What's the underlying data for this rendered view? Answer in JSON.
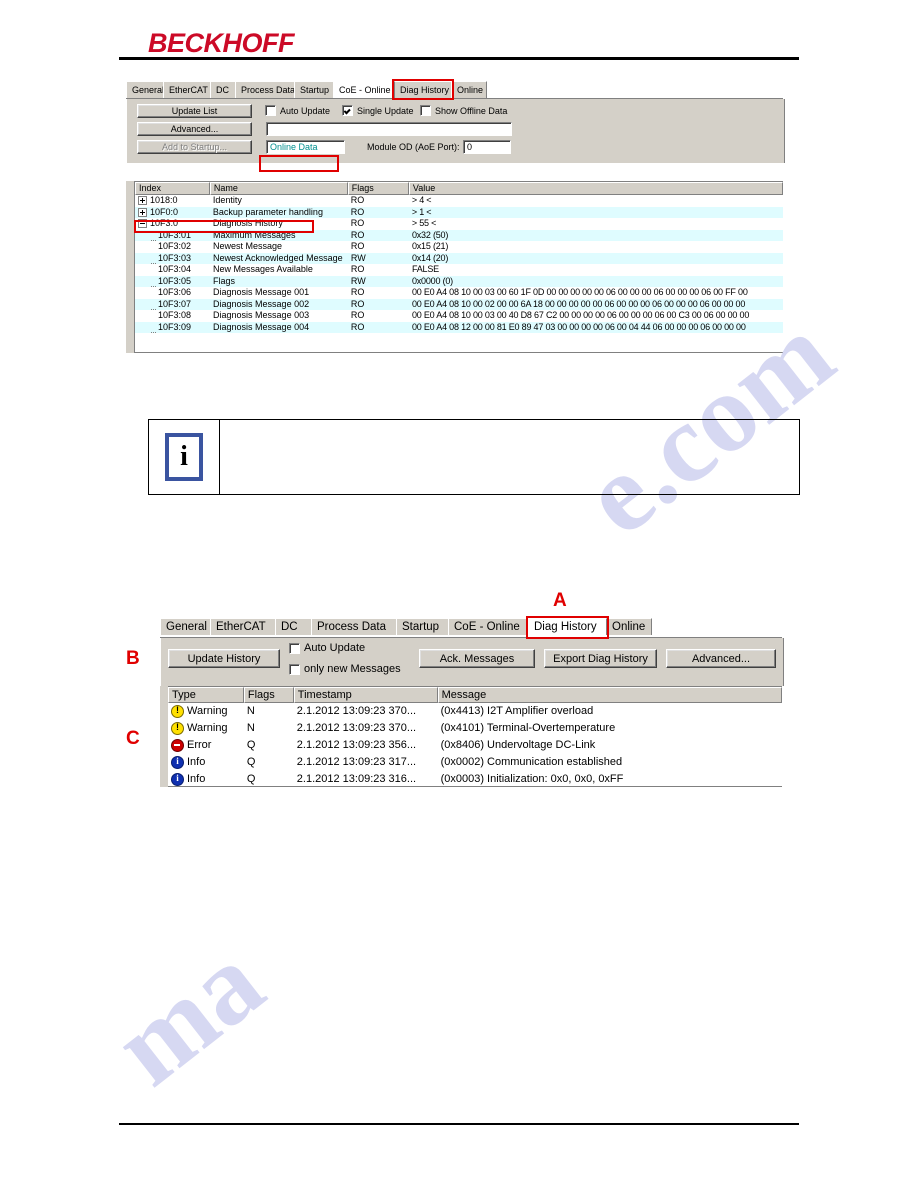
{
  "document": {
    "brand": "BECKHOFF"
  },
  "coe_online": {
    "tabs": [
      {
        "label": "General",
        "selected": false
      },
      {
        "label": "EtherCAT",
        "selected": false
      },
      {
        "label": "DC",
        "selected": false
      },
      {
        "label": "Process Data",
        "selected": false
      },
      {
        "label": "Startup",
        "selected": false
      },
      {
        "label": "CoE - Online",
        "selected": true
      },
      {
        "label": "Diag History",
        "selected": false,
        "highlight": true
      },
      {
        "label": "Online",
        "selected": false
      }
    ],
    "buttons": {
      "update_list": "Update List",
      "advanced": "Advanced...",
      "add_to_startup": "Add to Startup..."
    },
    "checkboxes": {
      "auto_update": {
        "label": "Auto Update",
        "checked": false
      },
      "single_update": {
        "label": "Single Update",
        "checked": true
      },
      "show_offline_data": {
        "label": "Show Offline Data",
        "checked": false
      }
    },
    "status_field": "",
    "online_data_field": "Online Data",
    "module_od_label": "Module OD (AoE Port):",
    "module_od_value": "0",
    "columns": [
      "Index",
      "Name",
      "Flags",
      "Value"
    ],
    "rows": [
      {
        "expander": "plus",
        "indent": 0,
        "index": "1018:0",
        "name": "Identity",
        "flags": "RO",
        "value": "> 4 <"
      },
      {
        "expander": "plus",
        "indent": 0,
        "index": "10F0:0",
        "name": "Backup parameter handling",
        "flags": "RO",
        "value": "> 1 <"
      },
      {
        "expander": "minus",
        "indent": 0,
        "index": "10F3:0",
        "name": "Diagnosis History",
        "flags": "RO",
        "value": "> 55 <",
        "highlight": true
      },
      {
        "expander": "leaf",
        "indent": 1,
        "index": "10F3:01",
        "name": "Maximum Messages",
        "flags": "RO",
        "value": "0x32 (50)"
      },
      {
        "expander": "leaf",
        "indent": 1,
        "index": "10F3:02",
        "name": "Newest Message",
        "flags": "RO",
        "value": "0x15 (21)"
      },
      {
        "expander": "leaf",
        "indent": 1,
        "index": "10F3:03",
        "name": "Newest Acknowledged Message",
        "flags": "RW",
        "value": "0x14 (20)"
      },
      {
        "expander": "leaf",
        "indent": 1,
        "index": "10F3:04",
        "name": "New Messages Available",
        "flags": "RO",
        "value": "FALSE"
      },
      {
        "expander": "leaf",
        "indent": 1,
        "index": "10F3:05",
        "name": "Flags",
        "flags": "RW",
        "value": "0x0000 (0)"
      },
      {
        "expander": "leaf",
        "indent": 1,
        "index": "10F3:06",
        "name": "Diagnosis Message 001",
        "flags": "RO",
        "value": "00 E0 A4 08 10 00 03 00 60 1F 0D 00 00 00 00 00 06 00 00 00 06 00 00 00 06 00 FF 00"
      },
      {
        "expander": "leaf",
        "indent": 1,
        "index": "10F3:07",
        "name": "Diagnosis Message 002",
        "flags": "RO",
        "value": "00 E0 A4 08 10 00 02 00 00 6A 18 00 00 00 00 00 06 00 00 00 06 00 00 00 06 00 00 00"
      },
      {
        "expander": "leaf",
        "indent": 1,
        "index": "10F3:08",
        "name": "Diagnosis Message 003",
        "flags": "RO",
        "value": "00 E0 A4 08 10 00 03 00 40 D8 67 C2 00 00 00 00 06 00 00 00 06 00 C3 00 06 00 00 00"
      },
      {
        "expander": "leaf",
        "indent": 1,
        "index": "10F3:09",
        "name": "Diagnosis Message 004",
        "flags": "RO",
        "value": "00 E0 A4 08 12 00 00 81 E0 89 47 03 00 00 00 00 06 00 04 44 06 00 00 00 06 00 00 00"
      }
    ]
  },
  "note": {
    "icon": "information-icon",
    "text": ""
  },
  "diag_history": {
    "callouts": {
      "a": "A",
      "b": "B",
      "c": "C"
    },
    "tabs": [
      {
        "label": "General",
        "selected": false
      },
      {
        "label": "EtherCAT",
        "selected": false
      },
      {
        "label": "DC",
        "selected": false
      },
      {
        "label": "Process Data",
        "selected": false
      },
      {
        "label": "Startup",
        "selected": false
      },
      {
        "label": "CoE - Online",
        "selected": false
      },
      {
        "label": "Diag History",
        "selected": true,
        "highlight": true
      },
      {
        "label": "Online",
        "selected": false
      }
    ],
    "buttons": {
      "update_history": "Update History",
      "ack_messages": "Ack. Messages",
      "export_diag_history": "Export Diag History",
      "advanced": "Advanced..."
    },
    "checkboxes": {
      "auto_update": {
        "label": "Auto Update",
        "checked": false
      },
      "only_new_messages": {
        "label": "only new Messages",
        "checked": false
      }
    },
    "columns": [
      "Type",
      "Flags",
      "Timestamp",
      "Message"
    ],
    "rows": [
      {
        "icon": "warning-icon",
        "type": "Warning",
        "flags": "N",
        "timestamp": "2.1.2012 13:09:23 370...",
        "message": "(0x4413) I2T Amplifier overload"
      },
      {
        "icon": "warning-icon",
        "type": "Warning",
        "flags": "N",
        "timestamp": "2.1.2012 13:09:23 370...",
        "message": "(0x4101) Terminal-Overtemperature"
      },
      {
        "icon": "error-icon",
        "type": "Error",
        "flags": "Q",
        "timestamp": "2.1.2012 13:09:23 356...",
        "message": "(0x8406) Undervoltage DC-Link"
      },
      {
        "icon": "info-icon",
        "type": "Info",
        "flags": "Q",
        "timestamp": "2.1.2012 13:09:23 317...",
        "message": "(0x0002) Communication established"
      },
      {
        "icon": "info-icon",
        "type": "Info",
        "flags": "Q",
        "timestamp": "2.1.2012 13:09:23 316...",
        "message": "(0x0003) Initialization: 0x0, 0x0, 0xFF"
      }
    ]
  },
  "watermark": {
    "line1": "e.com",
    "line2": "ma"
  },
  "colors": {
    "brand_red": "#cc0a27",
    "highlight_red": "#e00000",
    "window_face": "#d4d0c8",
    "row_alt": "#dffcff",
    "online_data_text": "#009090"
  }
}
